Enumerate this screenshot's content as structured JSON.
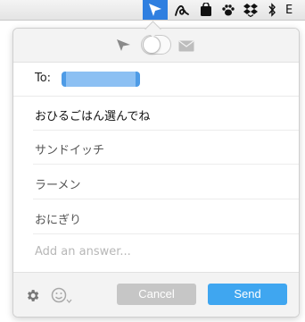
{
  "menubar": {
    "items": [
      "paper-plane-icon",
      "script-a-icon",
      "bag-icon",
      "paw-icon",
      "dropbox-icon",
      "bluetooth-icon"
    ],
    "truncated_label": "E"
  },
  "popover": {
    "mode_toggle": {
      "left_icon": "paper-plane-icon",
      "right_icon": "envelope-icon",
      "state": "left"
    },
    "to_label": "To:",
    "recipient": "",
    "question": "おひるごはん選んでね",
    "answers": [
      "サンドイッチ",
      "ラーメン",
      "おにぎり"
    ],
    "add_answer_placeholder": "Add an answer...",
    "footer": {
      "settings_icon": "gear-icon",
      "emoji_icon": "smiley-icon",
      "cancel_label": "Cancel",
      "send_label": "Send"
    }
  },
  "colors": {
    "menubar_highlight": "#2f7fe0",
    "recipient_chip": "#8cc0f3",
    "send_button": "#3fa6f0",
    "cancel_button": "#c6c6c6"
  }
}
